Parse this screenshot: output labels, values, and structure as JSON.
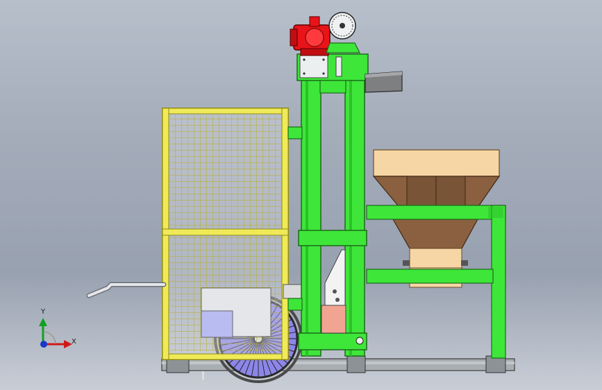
{
  "triad": {
    "x_label": "X",
    "y_label": "Y",
    "colors": {
      "x": "#d01818",
      "y": "#10a020",
      "z": "#1838c8"
    }
  },
  "palette": {
    "frame": "#3ee63a",
    "frame_dark": "#1f8f1c",
    "cage": "#f2ec52",
    "cage_dark": "#9c9418",
    "motor": "#e8141a",
    "hopper_top": "#f7d6a6",
    "hopper_body": "#8b6040",
    "wheel_tire": "#3a3a3a",
    "wheel_hub": "#8c86e8",
    "base": "#9aa0a4",
    "salmon": "#f2a493"
  }
}
